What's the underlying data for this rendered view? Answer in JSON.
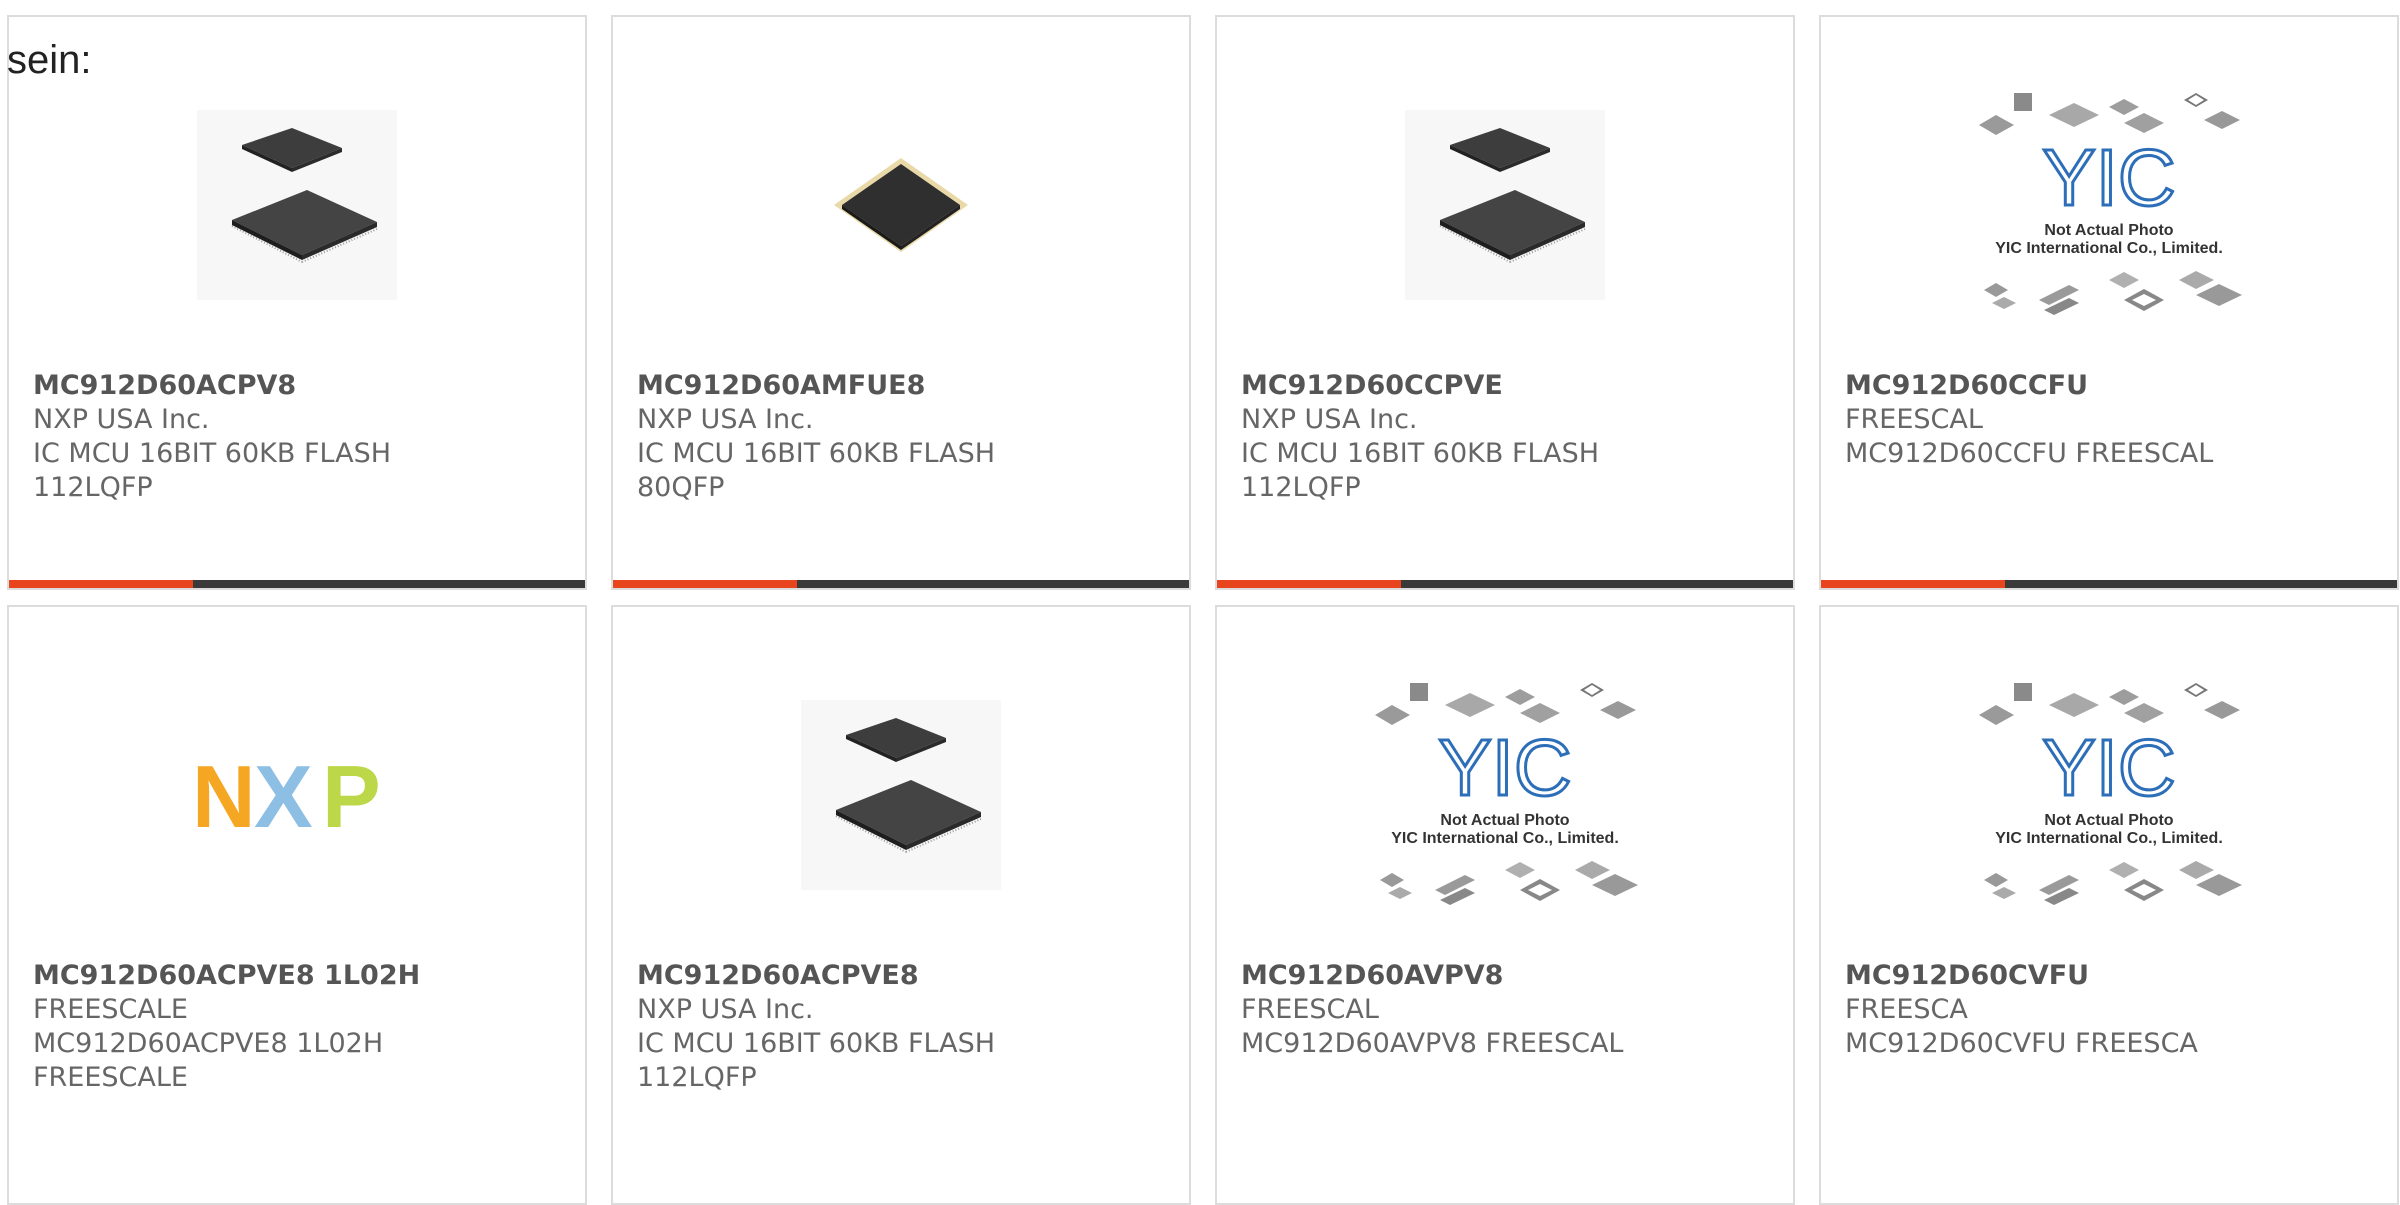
{
  "intro_text": "sein:",
  "colors": {
    "accent": "#e8451f",
    "bar": "#3a3a3a",
    "border": "#dcdcdc",
    "yic_blue": "#2d6eb8"
  },
  "products": [
    {
      "part": "MC912D60ACPV8",
      "lines": [
        "NXP USA Inc.",
        "IC MCU 16BIT 60KB FLASH",
        "112LQFP"
      ],
      "image": "qfp-chip-pair",
      "bar": true
    },
    {
      "part": "MC912D60AMFUE8",
      "lines": [
        "NXP USA Inc.",
        "IC MCU 16BIT 60KB FLASH",
        "80QFP"
      ],
      "image": "qfp-chip-single",
      "bar": true
    },
    {
      "part": "MC912D60CCPVE",
      "lines": [
        "NXP USA Inc.",
        "IC MCU 16BIT 60KB FLASH",
        "112LQFP"
      ],
      "image": "qfp-chip-pair",
      "bar": true
    },
    {
      "part": "MC912D60CCFU",
      "lines": [
        "FREESCAL",
        "MC912D60CCFU FREESCAL"
      ],
      "image": "yic-placeholder",
      "bar": true
    },
    {
      "part": "MC912D60ACPVE8 1L02H",
      "lines": [
        "FREESCALE",
        "MC912D60ACPVE8 1L02H",
        "FREESCALE"
      ],
      "image": "nxp-logo",
      "bar": false
    },
    {
      "part": "MC912D60ACPVE8",
      "lines": [
        "NXP USA Inc.",
        "IC MCU 16BIT 60KB FLASH",
        "112LQFP"
      ],
      "image": "qfp-chip-pair",
      "bar": false
    },
    {
      "part": "MC912D60AVPV8",
      "lines": [
        "FREESCAL",
        "MC912D60AVPV8 FREESCAL"
      ],
      "image": "yic-placeholder",
      "bar": false
    },
    {
      "part": "MC912D60CVFU",
      "lines": [
        "FREESCA",
        "MC912D60CVFU FREESCA"
      ],
      "image": "yic-placeholder",
      "bar": false
    }
  ],
  "yic": {
    "logo": "YIC",
    "caption1": "Not Actual Photo",
    "caption2": "YIC International Co., Limited."
  },
  "nxp_logo": {
    "letters": [
      "N",
      "X",
      "P"
    ],
    "colors": [
      "#f5a623",
      "#7ab3e0",
      "#b5d334"
    ]
  }
}
